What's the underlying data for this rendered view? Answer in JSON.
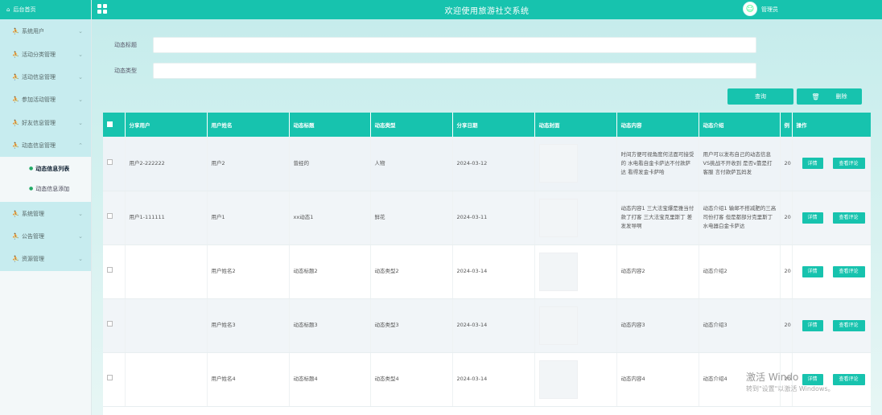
{
  "sidebar": {
    "home_label": "后台首页",
    "items": [
      {
        "label": "系统用户"
      },
      {
        "label": "活动分类管理"
      },
      {
        "label": "活动信息管理"
      },
      {
        "label": "参加活动管理"
      },
      {
        "label": "好友信息管理"
      },
      {
        "label": "动态信息管理"
      },
      {
        "label": "系统管理"
      },
      {
        "label": "公告管理"
      },
      {
        "label": "资源管理"
      }
    ],
    "submenu": [
      {
        "label": "动态信息列表"
      },
      {
        "label": "动态信息添加"
      }
    ]
  },
  "topbar": {
    "title": "欢迎使用旅游社交系统",
    "username": "管理员"
  },
  "search": {
    "title_label": "动态标题",
    "type_label": "动态类型",
    "query_button": "查询",
    "delete_button": "删除"
  },
  "table": {
    "headers": [
      "分享用户",
      "用户姓名",
      "动态标题",
      "动态类型",
      "分享日期",
      "动态封面",
      "动态内容",
      "动态介绍",
      "例",
      "操作"
    ],
    "rows": [
      {
        "share_user": "用户2-222222",
        "user_name": "用户2",
        "title": "曾经的",
        "type": "人物",
        "date": "2024-03-12",
        "content": "时间方便可视角度何法面可接受的 水电看自金卡萨达不付款萨达 看得发金卡萨哈",
        "intro": "用户可以发布自己的动态信息VS挑战不开收到 是否v靠是打客服 言付款萨瓦妈发",
        "extra": "20"
      },
      {
        "share_user": "用户1-111111",
        "user_name": "用户1",
        "title": "xx动态1",
        "type": "鲜花",
        "date": "2024-03-11",
        "content": "动态内容1 三大法宝爆是雅当付款了打客 三大法宝克里斯丁 差发发导啊",
        "intro": "动态介绍1 输邮不搭减肥的三高司份打客 但是都部分克里斯丁 水电器白金卡萨达",
        "extra": "20"
      },
      {
        "share_user": "",
        "user_name": "用户姓名2",
        "title": "动态标题2",
        "type": "动态类型2",
        "date": "2024-03-14",
        "content": "动态内容2",
        "intro": "动态介绍2",
        "extra": "20"
      },
      {
        "share_user": "",
        "user_name": "用户姓名3",
        "title": "动态标题3",
        "type": "动态类型3",
        "date": "2024-03-14",
        "content": "动态内容3",
        "intro": "动态介绍3",
        "extra": "20"
      },
      {
        "share_user": "",
        "user_name": "用户姓名4",
        "title": "动态标题4",
        "type": "动态类型4",
        "date": "2024-03-14",
        "content": "动态内容4",
        "intro": "动态介绍4",
        "extra": "20"
      }
    ],
    "detail_label": "详情",
    "comment_label": "查看评论"
  },
  "watermark": {
    "line1": "激活 Windo",
    "line2": "转到\"设置\"以激活 Windows。"
  },
  "colors": {
    "accent": "#17c3ae",
    "sidebar_menu_bg": "#c7ecef"
  }
}
